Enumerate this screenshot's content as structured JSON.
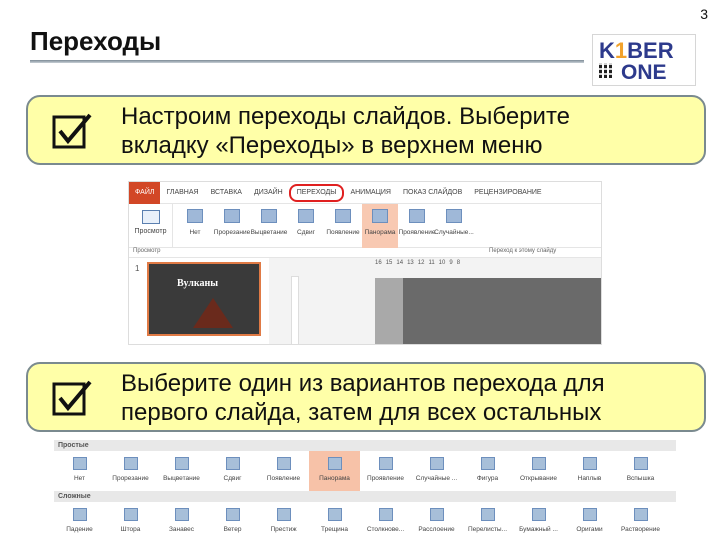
{
  "page_number": "3",
  "title": "Переходы",
  "logo": {
    "line1_a": "K",
    "line1_b": "1",
    "line1_c": "BER",
    "line2": "ONE"
  },
  "note1": "Настроим переходы слайдов. Выберите\nвкладку «Переходы» в верхнем меню",
  "note2": "Выберите один из вариантов перехода для\nпервого слайда, затем для всех остальных",
  "ribbon": {
    "tabs": [
      "ФАЙЛ",
      "ГЛАВНАЯ",
      "ВСТАВКА",
      "ДИЗАЙН",
      "ПЕРЕХОДЫ",
      "АНИМАЦИЯ",
      "ПОКАЗ СЛАЙДОВ",
      "РЕЦЕНЗИРОВАНИЕ"
    ],
    "preview_label": "Просмотр",
    "transitions": [
      "Нет",
      "Прорезание",
      "Выцветание",
      "Сдвиг",
      "Появление",
      "Панорама",
      "Проявление",
      "Случайные..."
    ],
    "group_preview": "Просмотр",
    "group_transition": "Переход к этому слайду"
  },
  "slide_thumb": {
    "number": "1",
    "title": "Вулканы"
  },
  "ruler_numbers": [
    "16",
    "15",
    "14",
    "13",
    "12",
    "11",
    "10",
    "9",
    "8"
  ],
  "gallery": {
    "simple_header": "Простые",
    "simple": [
      "Нет",
      "Прорезание",
      "Выцветание",
      "Сдвиг",
      "Появление",
      "Панорама",
      "Проявление",
      "Случайные ...",
      "Фигура",
      "Открывание",
      "Наплыв",
      "Вспышка"
    ],
    "complex_header": "Сложные",
    "complex": [
      "Падение",
      "Штора",
      "Занавес",
      "Ветер",
      "Престиж",
      "Трещина",
      "Столкнове...",
      "Расслоение",
      "Перелисты...",
      "Бумажный ...",
      "Оригами",
      "Растворение"
    ]
  }
}
